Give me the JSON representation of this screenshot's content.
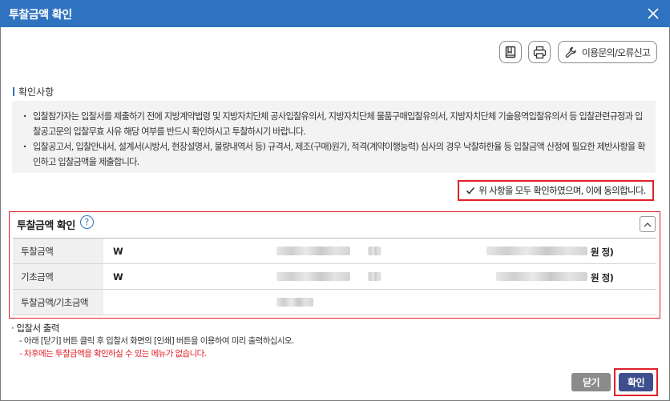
{
  "window": {
    "title": "투찰금액 확인"
  },
  "toolbar": {
    "inquiry_label": "이용문의/오류신고"
  },
  "notice": {
    "title": "확인사항",
    "items": [
      "입찰참가자는 입찰서를 제출하기 전에 지방계약법령 및 지방자치단체 공사입찰유의서, 지방자치단체 물품구매입찰유의서, 지방자치단체 기술용역입찰유의서 등 입찰관련규정과 입찰공고문의 입찰무효 사유 해당 여부를 반드시 확인하시고 투찰하시기 바랍니다.",
      "입찰공고서, 입찰안내서, 설계서(시방서, 현장설명서, 물량내역서 등) 규격서, 제조(구매)원가, 적격(계약이행능력) 심사의 경우 낙찰하한율 등 입찰금액 산정에 필요한 제반사항을 확인하고 입찰금액을 제출합니다."
    ],
    "agree_label": "위 사항을 모두 확인하였으며, 이에 동의합니다."
  },
  "bid": {
    "title": "투찰금액 확인",
    "help": "?",
    "rows": [
      {
        "label": "투찰금액",
        "currency": "W",
        "unit": "원 정)"
      },
      {
        "label": "기초금액",
        "currency": "W",
        "unit": "원 정)"
      },
      {
        "label": "투찰금액/기초금액",
        "currency": "",
        "unit": ""
      }
    ]
  },
  "footnotes": {
    "head": "입찰서 출력",
    "lines": [
      "- 아래 [닫기] 버튼 클릭 후 입찰서 화면의 [인쇄] 버튼을 이용하여 미리 출력하십시오.",
      "- 차후에는 투찰금액을 확인하실 수 있는 메뉴가 없습니다."
    ]
  },
  "buttons": {
    "close": "닫기",
    "confirm": "확인"
  },
  "colors": {
    "titlebar": "#2f73c0",
    "highlight": "#e0202a",
    "confirm": "#3d4f8e",
    "close": "#8b8b8b"
  }
}
